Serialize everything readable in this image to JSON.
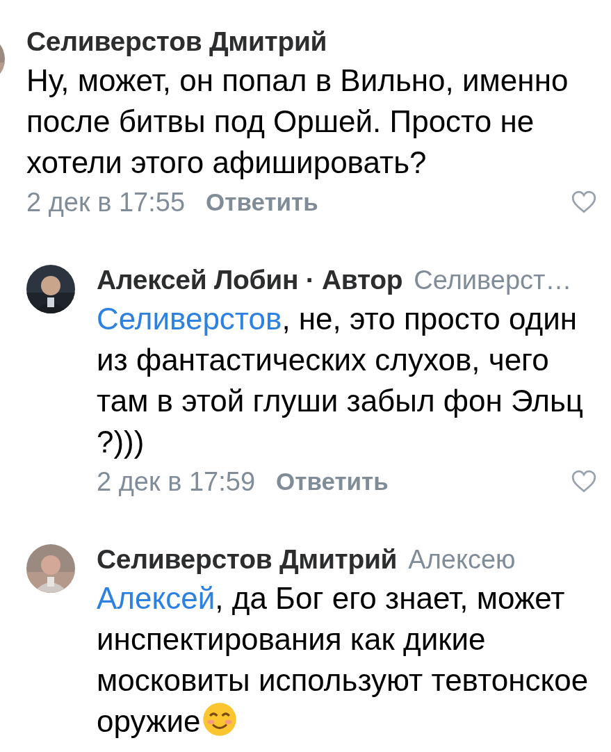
{
  "comments": [
    {
      "kind": "top",
      "author": "Селиверстов Дмитрий",
      "text": "Ну, может, он попал в Вильно, именно после битвы под Оршей. Просто не хотели этого афишировать?",
      "date": "2 дек в 17:55",
      "reply_label": "Ответить"
    },
    {
      "kind": "reply",
      "author": "Алексей Лобин · Автор",
      "reply_to": "Селиверст…",
      "mention": "Селиверстов",
      "text": ", не, это просто один из фантастических слухов, чего там в этой глуши забыл фон Эльц ?)))",
      "date": "2 дек в 17:59",
      "reply_label": "Ответить"
    },
    {
      "kind": "reply",
      "author": "Селиверстов Дмитрий",
      "reply_to": "Алексею",
      "mention": "Алексей",
      "text": ", да Бог его знает, может инспектирования как дикие московиты используют тевтонское оружие",
      "emoji": true
    }
  ]
}
